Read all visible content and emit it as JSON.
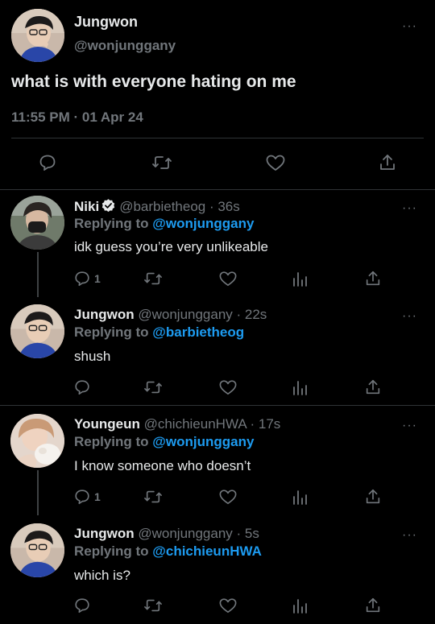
{
  "main": {
    "author_name": "Jungwon",
    "author_handle": "@wonjunggany",
    "text": "what is with everyone hating on me",
    "timestamp": "11:55 PM · 01 Apr 24",
    "menu_label": "···"
  },
  "replies": [
    {
      "name": "Niki",
      "verified": true,
      "handle_time": "@barbietheog · 36s",
      "replying_prefix": "Replying to ",
      "replying_to": "@wonjunggany",
      "text": "idk guess you’re very unlikeable",
      "reply_count": "1"
    },
    {
      "name": "Jungwon",
      "verified": false,
      "handle_time": "@wonjunggany · 22s",
      "replying_prefix": "Replying to ",
      "replying_to": "@barbietheog",
      "text": "shush",
      "reply_count": ""
    },
    {
      "name": "Youngeun",
      "verified": false,
      "handle_time": "@chichieunHWA · 17s",
      "replying_prefix": "Replying to ",
      "replying_to": "@wonjunggany",
      "text": "I know someone who doesn’t",
      "reply_count": "1"
    },
    {
      "name": "Jungwon",
      "verified": false,
      "handle_time": "@wonjunggany · 5s",
      "replying_prefix": "Replying to ",
      "replying_to": "@chichieunHWA",
      "text": "which is?",
      "reply_count": ""
    }
  ],
  "colors": {
    "background": "#000000",
    "text": "#e7e9ea",
    "muted": "#71767b",
    "link": "#1d9bf0",
    "divider": "#2f3336"
  },
  "icons": [
    "reply-icon",
    "retweet-icon",
    "like-icon",
    "views-icon",
    "share-icon",
    "verified-badge-icon",
    "more-icon"
  ]
}
